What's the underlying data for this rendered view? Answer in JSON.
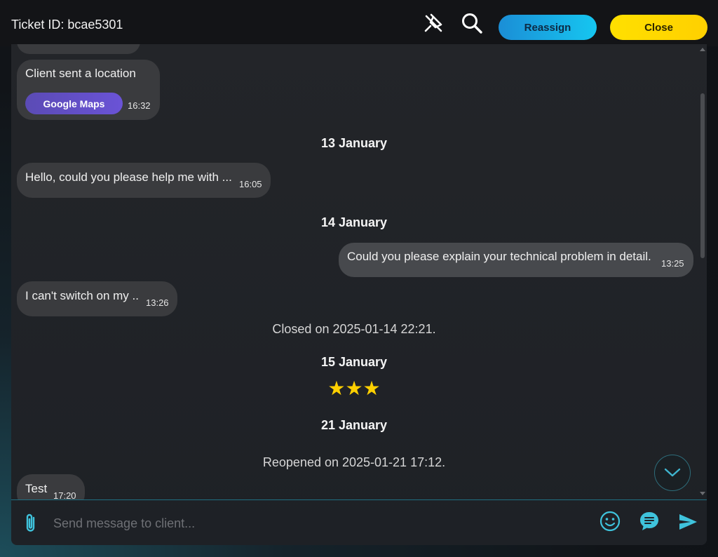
{
  "header": {
    "ticket_label": "Ticket ID: bcae5301",
    "reassign_label": "Reassign",
    "close_label": "Close"
  },
  "messages": [
    {
      "text": "Client sent a location",
      "button": "Google Maps",
      "time": "16:32"
    },
    {
      "text": "Hello, could you please help me with ...",
      "time": "16:05"
    },
    {
      "text": "Could you please explain your technical problem in detail.",
      "time": "13:25"
    },
    {
      "text": "I can't switch on my ..",
      "time": "13:26"
    },
    {
      "text": "Test",
      "time": "17:20"
    }
  ],
  "dates": [
    "13 January",
    "14 January",
    "15 January",
    "21 January"
  ],
  "system": {
    "closed": "Closed on 2025-01-14 22:21.",
    "reopened": "Reopened on 2025-01-21 17:12."
  },
  "rating": {
    "value": 3,
    "display": "★★★"
  },
  "composer": {
    "placeholder": "Send message to client..."
  },
  "colors": {
    "accent": "#16c6f0",
    "close": "#ffe000",
    "maps": "#6a53d6",
    "star": "#ffd000"
  }
}
